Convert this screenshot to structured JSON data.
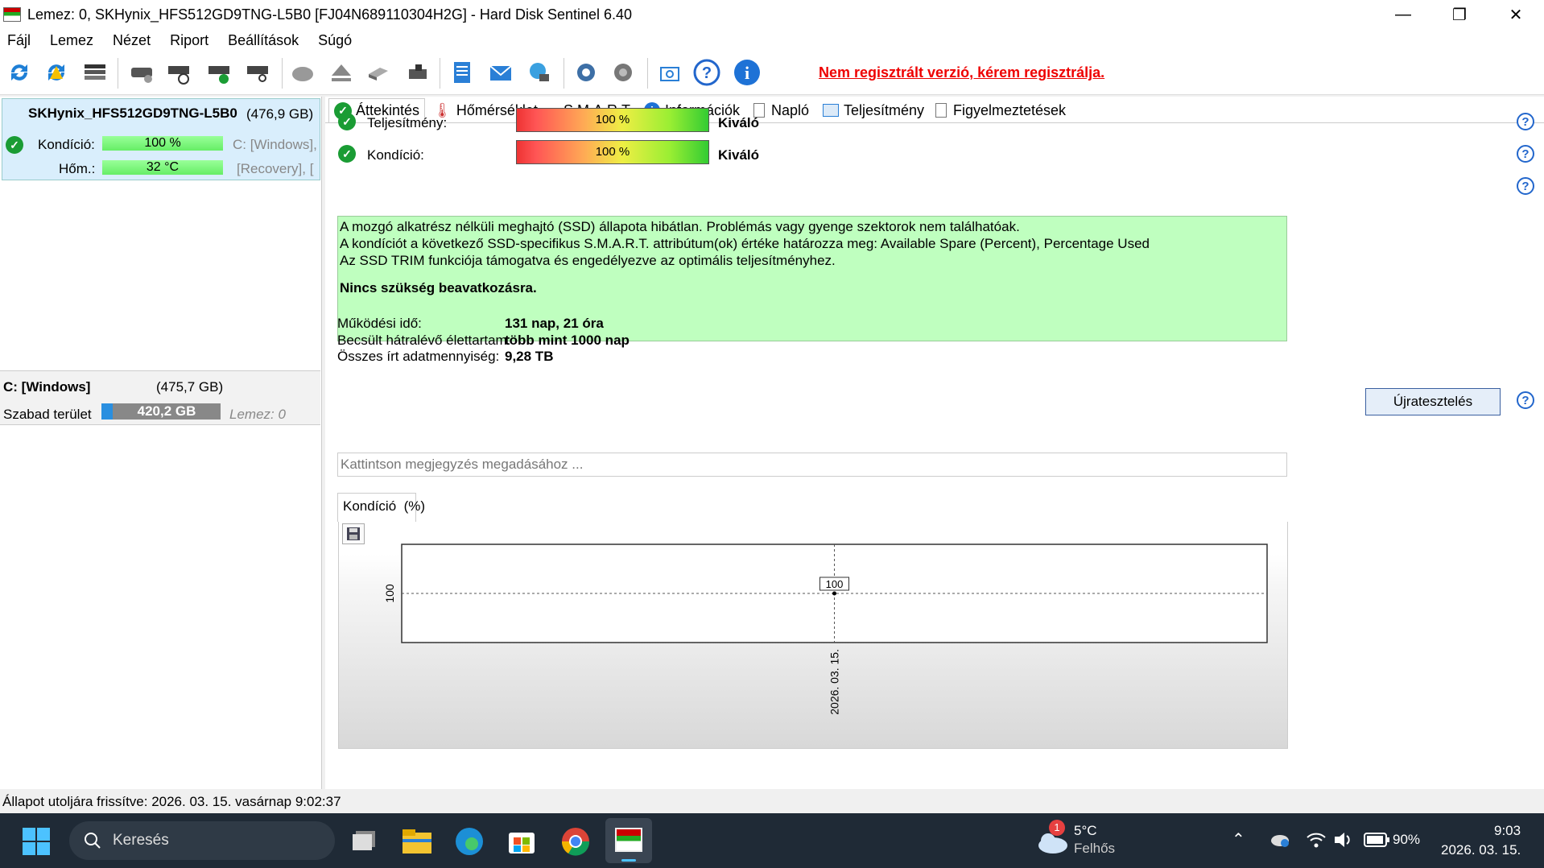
{
  "window": {
    "title": "Lemez: 0, SKHynix_HFS512GD9TNG-L5B0 [FJ04N689110304H2G]  -  Hard Disk Sentinel 6.40",
    "minimize": "—",
    "maximize": "❐",
    "close": "✕"
  },
  "menu": [
    "Fájl",
    "Lemez",
    "Nézet",
    "Riport",
    "Beállítások",
    "Súgó"
  ],
  "toolbar": {
    "register_text": "Nem regisztrált verzió, kérem regisztrálja."
  },
  "disk": {
    "name": "SKHynix_HFS512GD9TNG-L5B0",
    "size": "(476,9 GB)",
    "condition_label": "Kondíció:",
    "condition_value": "100 %",
    "condition_level": 1.0,
    "temp_label": "Hőm.:",
    "temp_value": "32 °C",
    "vol1": "C: [Windows],",
    "vol2": "[Recovery],  ["
  },
  "volume": {
    "name": "C: [Windows]",
    "size": "(475,7 GB)",
    "free_label": "Szabad terület",
    "free_value": "420,2 GB",
    "disk_ref": "Lemez: 0"
  },
  "tabs": [
    "Áttekintés",
    "Hőmérséklet",
    "S.M.A.R.T.",
    "Információk",
    "Napló",
    "Teljesítmény",
    "Figyelmeztetések"
  ],
  "overview": {
    "performance_label": "Teljesítmény:",
    "performance_value": "100 %",
    "performance_level": 1.0,
    "performance_rating": "Kiváló",
    "condition_label": "Kondíció:",
    "condition_value": "100 %",
    "condition_level": 1.0,
    "condition_rating": "Kiváló",
    "info_line1": "A mozgó alkatrész nélküli meghajtó (SSD) állapota hibátlan. Problémás vagy gyenge szektorok nem találhatóak.",
    "info_line2": "A kondíciót a következő SSD-specifikus S.M.A.R.T. attribútum(ok) értéke határozza meg:  Available Spare (Percent), Percentage Used",
    "info_line3": "Az SSD TRIM funkciója támogatva és engedélyezve az optimális teljesítményhez.",
    "info_bold": "Nincs szükség beavatkozásra.",
    "uptime_label": "Működési idő:",
    "uptime_value": "131 nap, 21 óra",
    "life_label": "Becsült hátralévő élettartam:",
    "life_value": "több mint 1000 nap",
    "written_label": "Összes írt adatmennyiség:",
    "written_value": "9,28 TB",
    "retest_button": "Újratesztelés",
    "note_placeholder": "Kattintson megjegyzés megadásához ..."
  },
  "chart_tab": {
    "label": "Kondíció",
    "unit": "(%)"
  },
  "chart_data": {
    "type": "line",
    "x": [
      "2026. 03. 15."
    ],
    "series": [
      {
        "values": [
          100
        ]
      }
    ],
    "data_labels": [
      "100"
    ],
    "ytick": "100",
    "xtick": "2026. 03. 15.",
    "grid": true
  },
  "status": {
    "text": "Állapot utoljára frissítve: 2026. 03. 15. vasárnap 9:02:37"
  },
  "taskbar": {
    "search": "Keresés",
    "weather_temp": "5°C",
    "weather_desc": "Felhős",
    "weather_badge": "1",
    "battery": "90%",
    "time": "9:03",
    "date": "2026. 03. 15."
  }
}
